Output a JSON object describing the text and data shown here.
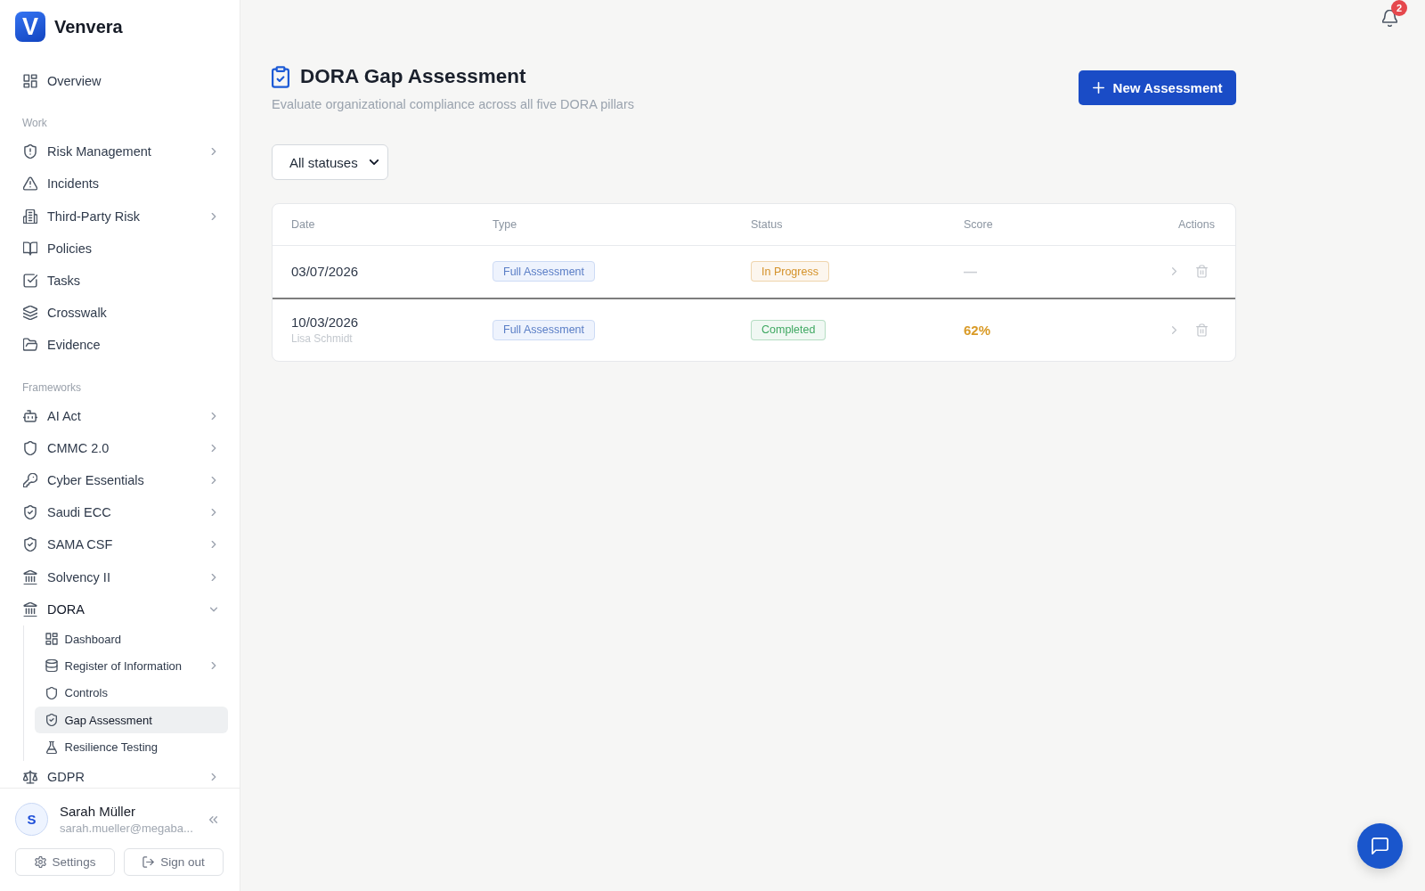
{
  "brand": {
    "mark": "V",
    "name": "Venvera"
  },
  "notifications": {
    "count": "2"
  },
  "sidebar": {
    "sections": [
      {
        "items": [
          {
            "label": "Overview",
            "kind": "link",
            "selected": false
          }
        ]
      },
      {
        "title": "Work",
        "items": [
          {
            "label": "Risk Management",
            "kind": "group",
            "expanded": false,
            "selected": false
          },
          {
            "label": "Incidents",
            "kind": "link",
            "selected": false
          },
          {
            "label": "Third-Party Risk",
            "kind": "group",
            "expanded": false,
            "selected": false
          },
          {
            "label": "Policies",
            "kind": "link",
            "selected": false
          },
          {
            "label": "Tasks",
            "kind": "link",
            "selected": false
          },
          {
            "label": "Crosswalk",
            "kind": "link",
            "selected": false
          },
          {
            "label": "Evidence",
            "kind": "link",
            "selected": false
          }
        ]
      },
      {
        "title": "Frameworks",
        "items": [
          {
            "label": "AI Act",
            "kind": "group",
            "expanded": false,
            "selected": false
          },
          {
            "label": "CMMC 2.0",
            "kind": "group",
            "expanded": false,
            "selected": false
          },
          {
            "label": "Cyber Essentials",
            "kind": "group",
            "expanded": false,
            "selected": false
          },
          {
            "label": "Saudi ECC",
            "kind": "group",
            "expanded": false,
            "selected": false
          },
          {
            "label": "SAMA CSF",
            "kind": "group",
            "expanded": false,
            "selected": false
          },
          {
            "label": "Solvency II",
            "kind": "group",
            "expanded": false,
            "selected": false
          },
          {
            "label": "DORA",
            "kind": "group",
            "expanded": true,
            "selected": false,
            "children": [
              {
                "label": "Dashboard",
                "kind": "link",
                "selected": false
              },
              {
                "label": "Register of Information",
                "kind": "group",
                "expanded": false,
                "selected": false
              },
              {
                "label": "Controls",
                "kind": "link",
                "selected": false
              },
              {
                "label": "Gap Assessment",
                "kind": "link",
                "selected": true
              },
              {
                "label": "Resilience Testing",
                "kind": "link",
                "selected": false
              }
            ]
          },
          {
            "label": "GDPR",
            "kind": "group",
            "expanded": false,
            "selected": false
          }
        ]
      }
    ],
    "user": {
      "initial": "S",
      "name": "Sarah Müller",
      "email": "sarah.mueller@megaba..."
    },
    "footer_buttons": [
      "Settings",
      "Sign out"
    ]
  },
  "page": {
    "title": "DORA Gap Assessment",
    "subtitle": "Evaluate organizational compliance across all five DORA pillars",
    "primary_action": "New Assessment",
    "filter": {
      "value": "All statuses"
    },
    "table": {
      "columns": [
        "Date",
        "Type",
        "Status",
        "Score",
        "Actions"
      ],
      "rows": [
        {
          "date": "03/07/2026",
          "type": "Full Assessment",
          "status": {
            "text": "In Progress",
            "color": "#d4922a"
          },
          "score": {
            "text": "—",
            "color": "#c9cdd2"
          }
        },
        {
          "date": "10/03/2026",
          "author": "Lisa Schmidt",
          "type": "Full Assessment",
          "status": {
            "text": "Completed",
            "color": "#3fa862"
          },
          "score": {
            "text": "62%",
            "color": "#d99a26"
          }
        }
      ]
    }
  }
}
